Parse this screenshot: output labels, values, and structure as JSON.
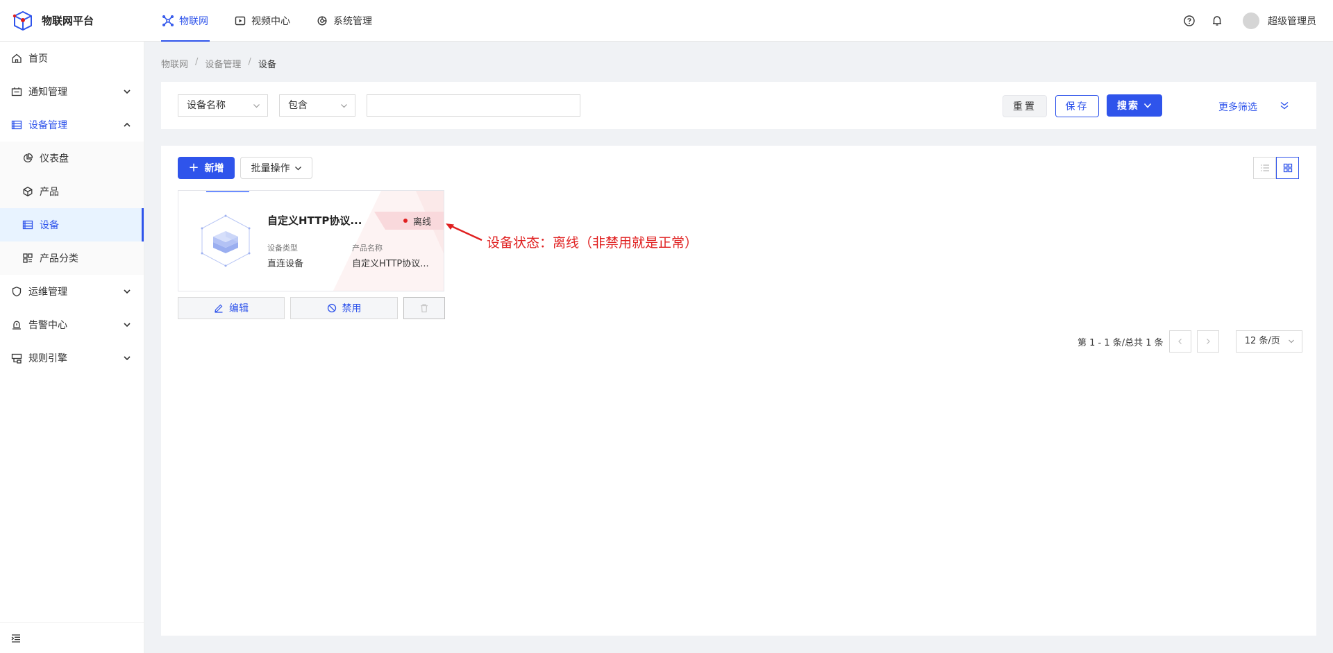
{
  "app": {
    "title": "物联网平台"
  },
  "topnav": [
    {
      "label": "物联网",
      "icon": "iot-icon",
      "active": true
    },
    {
      "label": "视频中心",
      "icon": "video-icon",
      "active": false
    },
    {
      "label": "系统管理",
      "icon": "system-icon",
      "active": false
    }
  ],
  "user": {
    "name": "超级管理员"
  },
  "sidebar": {
    "items": [
      {
        "label": "首页"
      },
      {
        "label": "通知管理"
      },
      {
        "label": "设备管理"
      },
      {
        "label": "仪表盘"
      },
      {
        "label": "产品"
      },
      {
        "label": "设备"
      },
      {
        "label": "产品分类"
      },
      {
        "label": "运维管理"
      },
      {
        "label": "告警中心"
      },
      {
        "label": "规则引擎"
      }
    ]
  },
  "breadcrumb": [
    "物联网",
    "设备管理",
    "设备"
  ],
  "filter": {
    "field": "设备名称",
    "operator": "包含",
    "value": "",
    "reset": "重置",
    "save": "保存",
    "search": "搜索",
    "more": "更多筛选"
  },
  "toolbar": {
    "add": "新增",
    "batch": "批量操作"
  },
  "card": {
    "title": "自定义HTTP协议...",
    "status": "离线",
    "status_color": "#e02020",
    "device_type_label": "设备类型",
    "device_type": "直连设备",
    "product_label": "产品名称",
    "product": "自定义HTTP协议...",
    "edit": "编辑",
    "disable": "禁用"
  },
  "pagination": {
    "summary": "第 1 - 1 条/总共 1 条",
    "page_size": "12 条/页"
  },
  "annotation": {
    "text": "设备状态：离线（非禁用就是正常）",
    "color": "#e02020"
  },
  "colors": {
    "primary": "#2f54eb"
  }
}
